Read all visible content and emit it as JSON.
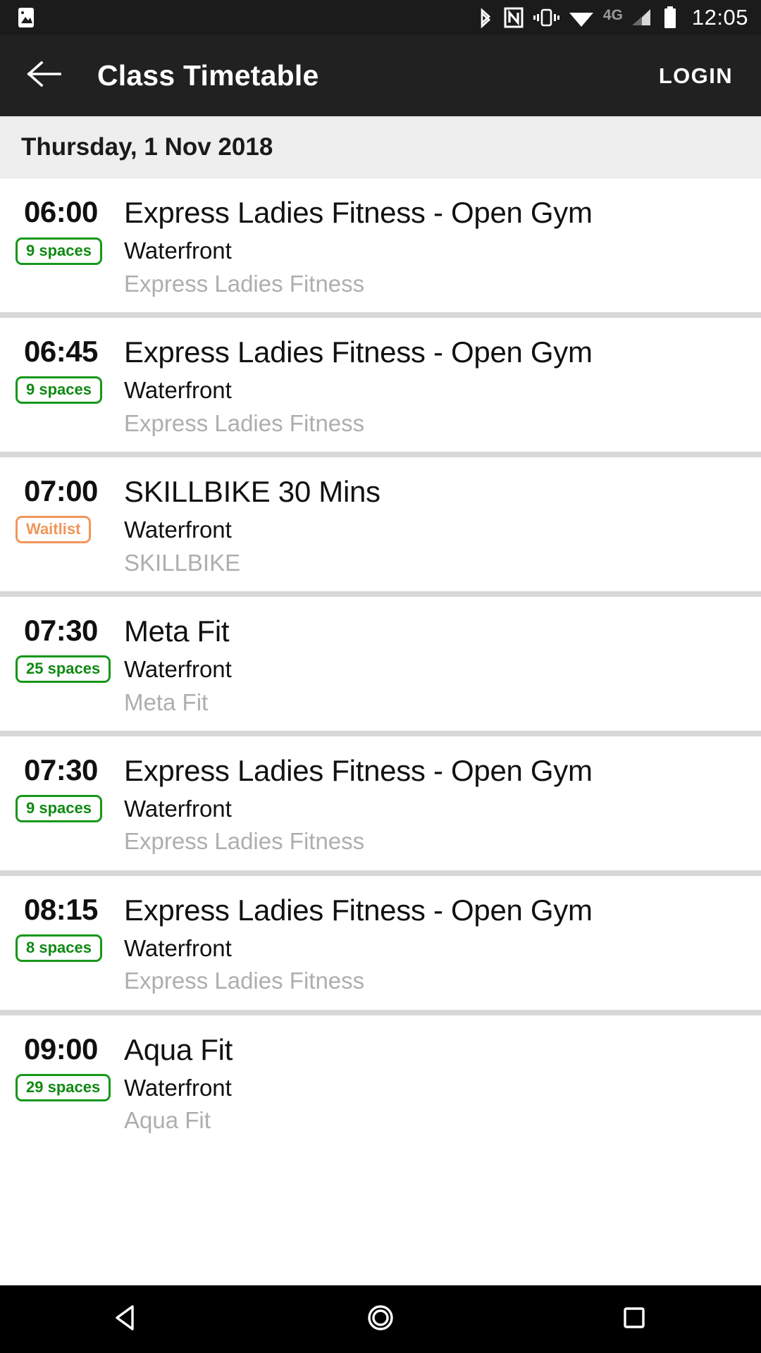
{
  "statusbar": {
    "time": "12:05",
    "network_label": "4G",
    "icons": [
      "image-icon",
      "bluetooth-icon",
      "nfc-icon",
      "vibrate-icon",
      "wifi-icon",
      "network-4g-label",
      "signal-icon",
      "battery-icon"
    ]
  },
  "appbar": {
    "back_icon": "back-arrow-icon",
    "title": "Class Timetable",
    "login_label": "LOGIN"
  },
  "date_header": {
    "text": "Thursday, 1 Nov 2018"
  },
  "colors": {
    "badge_green_border": "#17971a",
    "badge_green_text": "#0f8a12",
    "badge_orange": "#f0965a",
    "appbar_bg": "#212121",
    "statusbar_bg": "#1b1b1b",
    "date_header_bg": "#eeeeee",
    "category_text": "#aeaeae",
    "row_separator": "#d8d8d8"
  },
  "classes": [
    {
      "time": "06:00",
      "badge": {
        "label": "9 spaces",
        "style": "green"
      },
      "title": "Express Ladies Fitness - Open Gym",
      "location": "Waterfront",
      "category": "Express Ladies Fitness"
    },
    {
      "time": "06:45",
      "badge": {
        "label": "9 spaces",
        "style": "green"
      },
      "title": "Express Ladies Fitness - Open Gym",
      "location": "Waterfront",
      "category": "Express Ladies Fitness"
    },
    {
      "time": "07:00",
      "badge": {
        "label": "Waitlist",
        "style": "orange"
      },
      "title": "SKILLBIKE 30 Mins",
      "location": "Waterfront",
      "category": "SKILLBIKE"
    },
    {
      "time": "07:30",
      "badge": {
        "label": "25 spaces",
        "style": "green"
      },
      "title": "Meta Fit",
      "location": "Waterfront",
      "category": "Meta Fit"
    },
    {
      "time": "07:30",
      "badge": {
        "label": "9 spaces",
        "style": "green"
      },
      "title": "Express Ladies Fitness - Open Gym",
      "location": "Waterfront",
      "category": "Express Ladies Fitness"
    },
    {
      "time": "08:15",
      "badge": {
        "label": "8 spaces",
        "style": "green"
      },
      "title": "Express Ladies Fitness - Open Gym",
      "location": "Waterfront",
      "category": "Express Ladies Fitness"
    },
    {
      "time": "09:00",
      "badge": {
        "label": "29 spaces",
        "style": "green"
      },
      "title": "Aqua Fit",
      "location": "Waterfront",
      "category": "Aqua Fit"
    }
  ],
  "navbar": {
    "back": "nav-back-icon",
    "home": "nav-home-icon",
    "recents": "nav-recents-icon"
  }
}
